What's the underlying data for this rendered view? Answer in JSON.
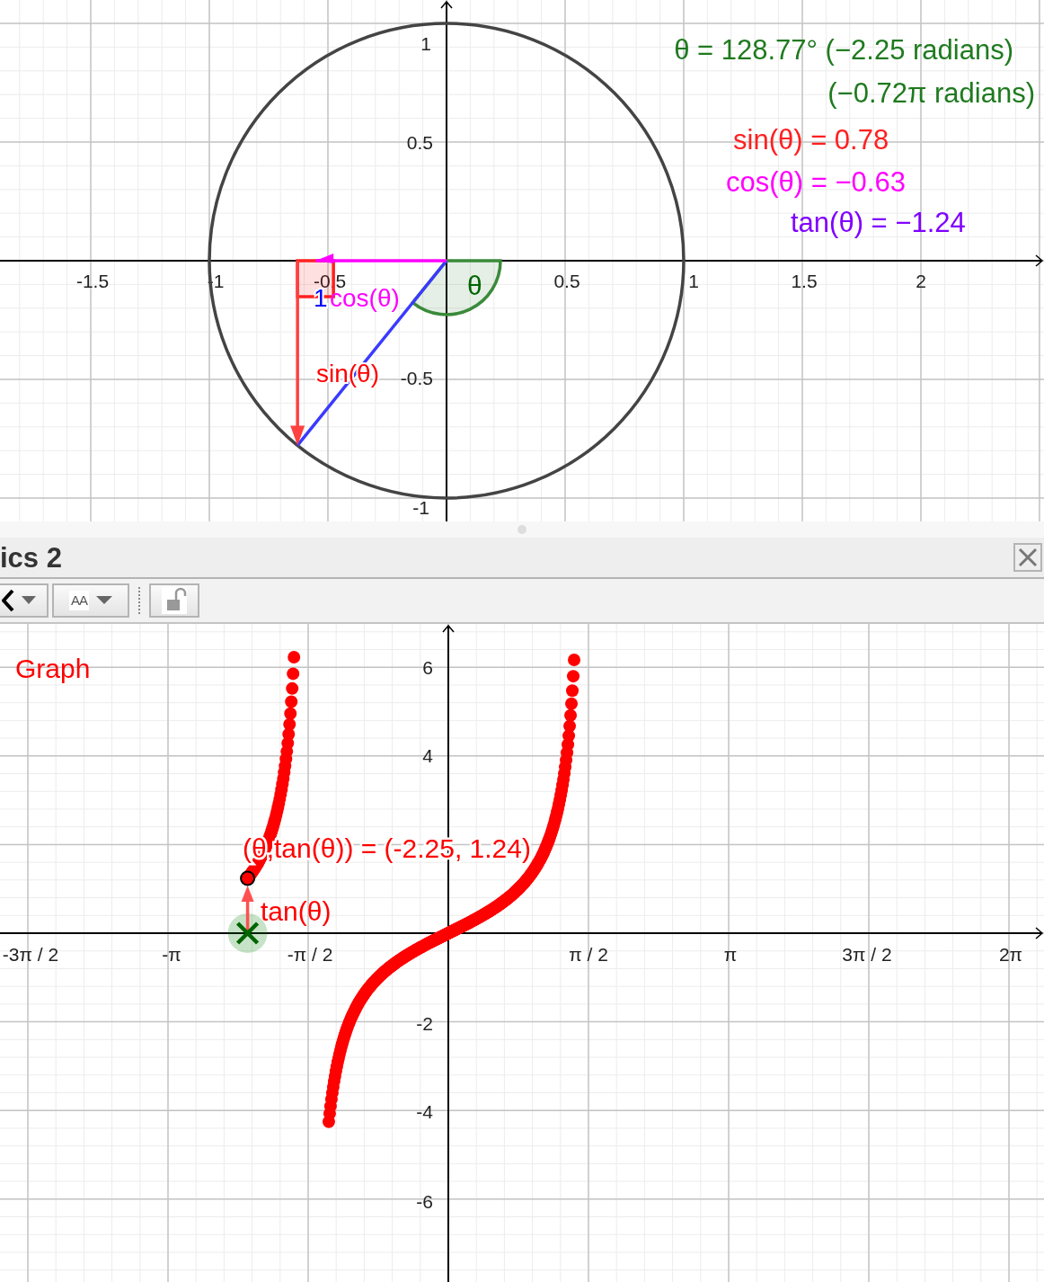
{
  "top_view": {
    "x_ticks": [
      "-1.5",
      "-1",
      "-0.5",
      "0.5",
      "1",
      "1.5",
      "2"
    ],
    "y_ticks": [
      "1",
      "0.5",
      "-0.5",
      "-1"
    ],
    "figure_labels": {
      "radius": "1",
      "cos": "cos(θ)",
      "sin": "sin(θ)",
      "angle": "θ"
    },
    "readouts": [
      {
        "text": "θ = 128.77° (−2.25 radians)",
        "color": "#1f7a1f"
      },
      {
        "text": "(−0.72π radians)",
        "color": "#1f7a1f"
      },
      {
        "text": "sin(θ) = 0.78",
        "color": "#ff2020"
      },
      {
        "text": "cos(θ) = −0.63",
        "color": "#ff00ff"
      },
      {
        "text": "tan(θ) = −1.24",
        "color": "#8000ff"
      }
    ]
  },
  "graphics_2": {
    "title": "ics 2",
    "toolbar": [
      {
        "kind": "point-style"
      },
      {
        "kind": "text-style",
        "label": "AA"
      },
      {
        "kind": "lock"
      }
    ],
    "view": {
      "caption": "Graph",
      "x_ticks": [
        "-3π / 2",
        "-π",
        "-π / 2",
        "π / 2",
        "π",
        "3π / 2",
        "2π"
      ],
      "y_ticks": [
        "6",
        "4",
        "-2",
        "-4",
        "-6"
      ],
      "point_label": "(θ,tan(θ)) = (-2.25, 1.24)",
      "arrow_label": "tan(θ)"
    }
  }
}
